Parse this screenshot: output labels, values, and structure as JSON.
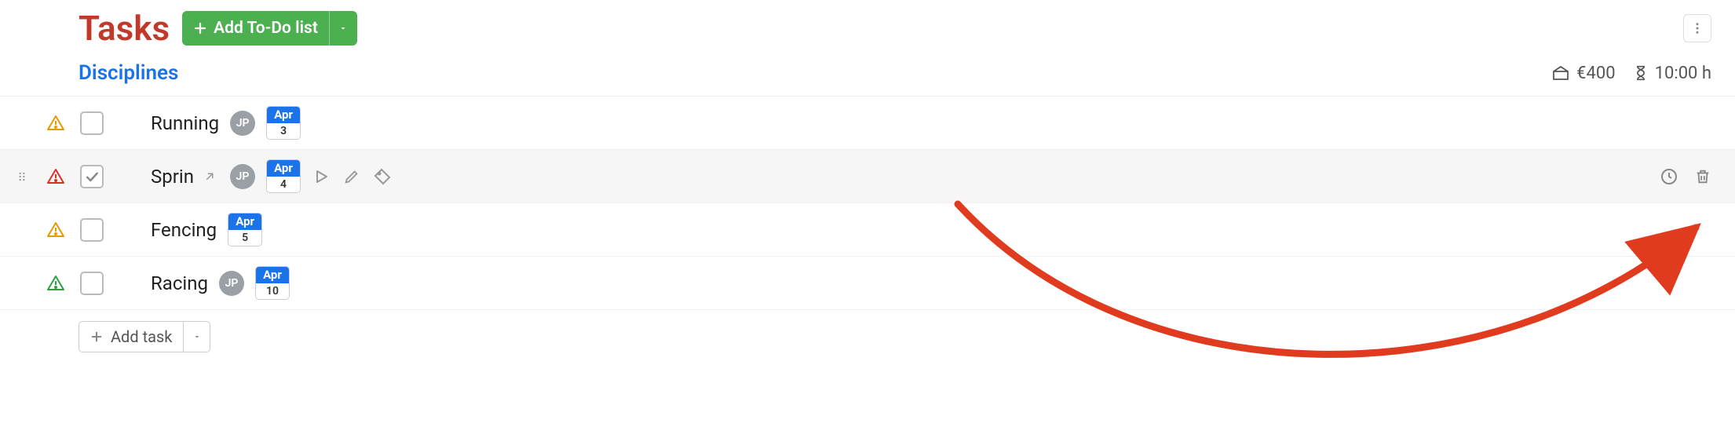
{
  "header": {
    "title": "Tasks",
    "add_button_label": "Add To-Do list"
  },
  "subheader": {
    "title": "Disciplines",
    "budget": "€400",
    "time": "10:00 h"
  },
  "tasks": [
    {
      "name": "Running",
      "alert": "orange",
      "checked": false,
      "avatar": "JP",
      "month": "Apr",
      "day": "3",
      "active": false,
      "show_avatar": true
    },
    {
      "name": "Sprin",
      "alert": "red",
      "checked": true,
      "avatar": "JP",
      "month": "Apr",
      "day": "4",
      "active": true,
      "show_avatar": true
    },
    {
      "name": "Fencing",
      "alert": "orange",
      "checked": false,
      "avatar": null,
      "month": "Apr",
      "day": "5",
      "active": false,
      "show_avatar": false
    },
    {
      "name": "Racing",
      "alert": "green",
      "checked": false,
      "avatar": "JP",
      "month": "Apr",
      "day": "10",
      "active": false,
      "show_avatar": true
    }
  ],
  "footer": {
    "add_task_label": "Add task"
  }
}
